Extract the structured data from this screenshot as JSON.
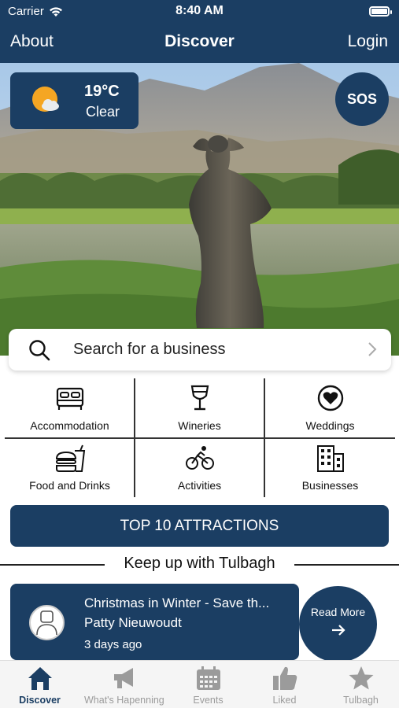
{
  "status_bar": {
    "carrier": "Carrier",
    "time": "8:40 AM",
    "icons": [
      "wifi-icon",
      "battery-icon"
    ]
  },
  "nav": {
    "left": "About",
    "title": "Discover",
    "right": "Login"
  },
  "weather": {
    "temperature": "19°C",
    "condition": "Clear",
    "icon": "partly-sunny-icon"
  },
  "sos_label": "SOS",
  "search": {
    "placeholder": "Search for a business",
    "icon": "search-icon"
  },
  "categories": [
    {
      "label": "Accommodation",
      "icon": "bed-icon"
    },
    {
      "label": "Wineries",
      "icon": "wine-glass-icon"
    },
    {
      "label": "Weddings",
      "icon": "heart-circle-icon"
    },
    {
      "label": "Food and Drinks",
      "icon": "fastfood-icon"
    },
    {
      "label": "Activities",
      "icon": "bicycle-icon"
    },
    {
      "label": "Businesses",
      "icon": "buildings-icon"
    }
  ],
  "top10_label": "TOP 10 ATTRACTIONS",
  "section_title": "Keep up with Tulbagh",
  "news": {
    "title": "Christmas in Winter - Save th...",
    "author": "Patty Nieuwoudt",
    "time_ago": "3 days ago",
    "read_more": "Read More"
  },
  "tabs": [
    {
      "label": "Discover",
      "icon": "home-icon",
      "active": true
    },
    {
      "label": "What's Hapenning",
      "icon": "megaphone-icon",
      "active": false
    },
    {
      "label": "Events",
      "icon": "calendar-icon",
      "active": false
    },
    {
      "label": "Liked",
      "icon": "thumbs-up-icon",
      "active": false
    },
    {
      "label": "Tulbagh",
      "icon": "star-icon",
      "active": false
    }
  ],
  "colors": {
    "primary": "#1b3e63",
    "tab_inactive": "#9b9b9b",
    "background": "#ffffff"
  }
}
